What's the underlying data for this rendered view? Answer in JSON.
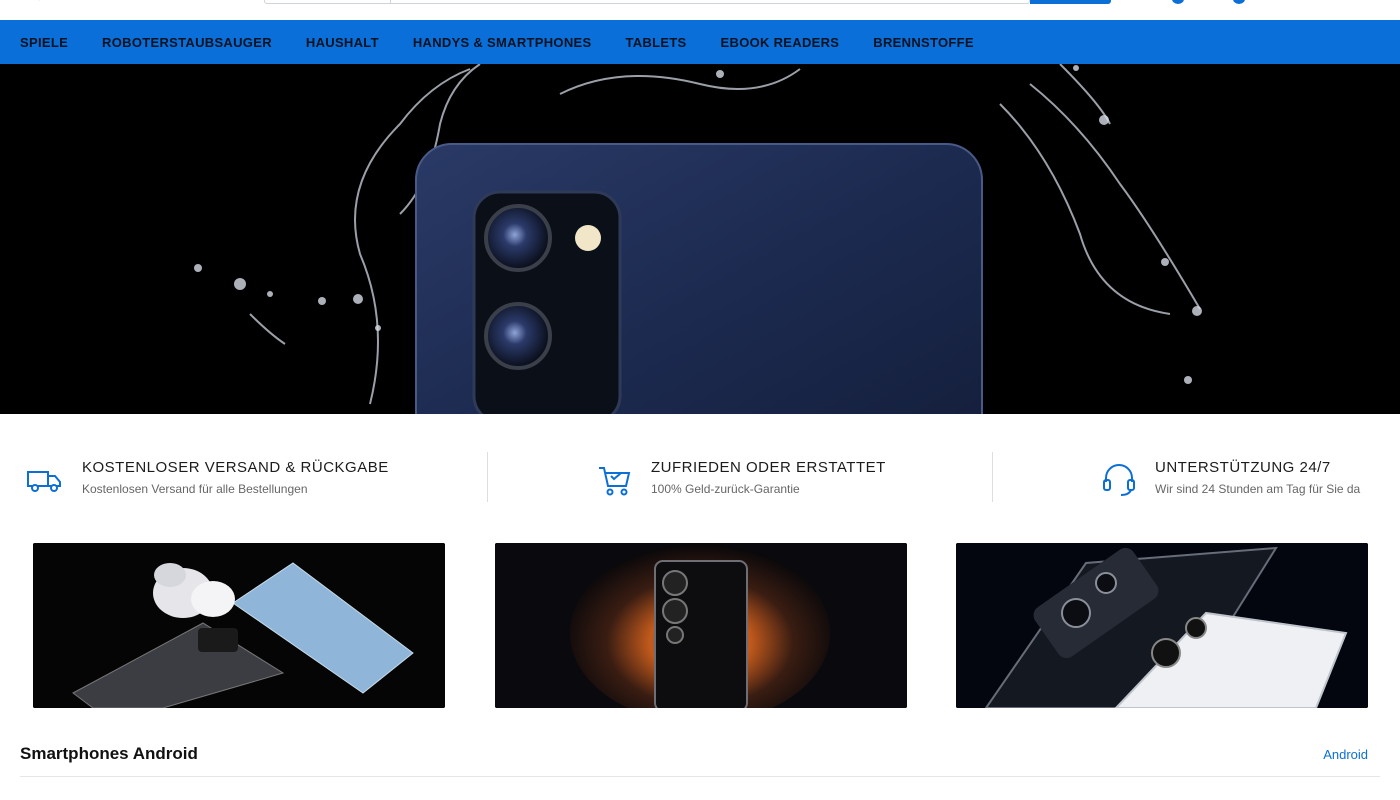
{
  "nav": {
    "items": [
      "SPIELE",
      "ROBOTERSTAUBSAUGER",
      "HAUSHALT",
      "HANDYS & SMARTPHONES",
      "TABLETS",
      "EBOOK READERS",
      "BRENNSTOFFE"
    ]
  },
  "features": [
    {
      "icon": "truck-icon",
      "title": "KOSTENLOSER VERSAND & RÜCKGABE",
      "subtitle": "Kostenlosen Versand für alle Bestellungen"
    },
    {
      "icon": "cart-icon",
      "title": "ZUFRIEDEN ODER ERSTATTET",
      "subtitle": "100% Geld-zurück-Garantie"
    },
    {
      "icon": "headset-icon",
      "title": "UNTERSTÜTZUNG 24/7",
      "subtitle": "Wir sind 24 Stunden am Tag für Sie da"
    }
  ],
  "section": {
    "title": "Smartphones Android",
    "link": "Android"
  },
  "colors": {
    "accent": "#0a6fd8",
    "link": "#0b6fd6"
  }
}
